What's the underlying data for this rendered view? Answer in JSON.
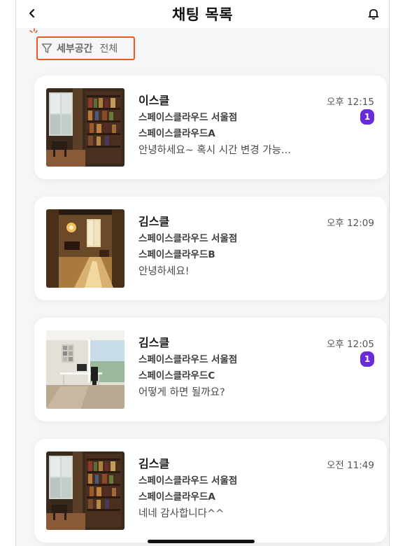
{
  "header": {
    "title": "채팅 목록",
    "back_icon": "chevron-left-icon",
    "bell_icon": "bell-icon"
  },
  "filter": {
    "icon": "funnel-icon",
    "label": "세부공간",
    "value": "전체",
    "highlight_color": "#ea5b1f"
  },
  "chats": [
    {
      "name": "이스클",
      "place": "스페이스클라우드 서울점",
      "space": "스페이스클라우드A",
      "message": "안녕하세요~ 혹시 시간 변경 가능...",
      "time": "오후 12:15",
      "unread": "1",
      "thumbnail": "library-room-photo"
    },
    {
      "name": "김스클",
      "place": "스페이스클라우드 서울점",
      "space": "스페이스클라우드B",
      "message": "안녕하세요!",
      "time": "오후 12:09",
      "unread": null,
      "thumbnail": "piano-hall-photo"
    },
    {
      "name": "김스클",
      "place": "스페이스클라우드 서울점",
      "space": "스페이스클라우드C",
      "message": "어떻게 하면 될까요?",
      "time": "오후 12:05",
      "unread": "1",
      "thumbnail": "bright-office-photo"
    },
    {
      "name": "김스클",
      "place": "스페이스클라우드 서울점",
      "space": "스페이스클라우드A",
      "message": "네네 감사합니다^^",
      "time": "오전 11:49",
      "unread": null,
      "thumbnail": "library-room-photo"
    }
  ],
  "colors": {
    "badge": "#6a2bd9",
    "background": "#f5f6f8"
  }
}
